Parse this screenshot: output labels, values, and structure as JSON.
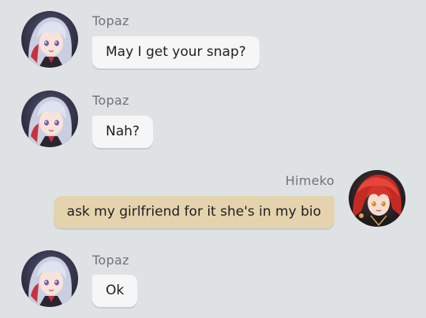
{
  "messages": [
    {
      "sender": "Topaz",
      "text": "May I get your snap?",
      "side": "left",
      "avatar": "topaz-avatar"
    },
    {
      "sender": "Topaz",
      "text": "Nah?",
      "side": "left",
      "avatar": "topaz-avatar"
    },
    {
      "sender": "Himeko",
      "text": "ask my girlfriend for it she's in my bio",
      "side": "right",
      "avatar": "himeko-avatar"
    },
    {
      "sender": "Topaz",
      "text": "Ok",
      "side": "left",
      "avatar": "topaz-avatar"
    }
  ],
  "colors": {
    "background": "#dfe2e5",
    "incoming_bubble": "#f6f6f6",
    "outgoing_bubble": "#e4d3ad",
    "sender_name": "#6f7378"
  }
}
